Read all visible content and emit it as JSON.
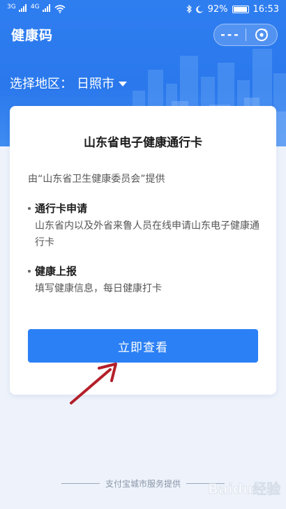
{
  "status_bar": {
    "signal_1": "3G",
    "signal_2": "4G",
    "battery": "92%",
    "time": "16:53",
    "icons": [
      "wifi-icon",
      "bluetooth-icon",
      "moon-icon",
      "battery-icon"
    ]
  },
  "header": {
    "title": "健康码",
    "more_icon": "more-icon",
    "close_icon": "close-icon"
  },
  "region": {
    "label": "选择地区：",
    "city": "日照市",
    "dropdown_icon": "caret-down-icon"
  },
  "card": {
    "title": "山东省电子健康通行卡",
    "provider": "由“山东省卫生健康委员会”提供",
    "sections": [
      {
        "heading": "通行卡申请",
        "body": "山东省内以及外省来鲁人员在线申请山东电子健康通行卡"
      },
      {
        "heading": "健康上报",
        "body": "填写健康信息，每日健康打卡"
      }
    ],
    "button_label": "立即查看"
  },
  "footer": {
    "text": "支付宝城市服务提供"
  },
  "watermark": {
    "text": "Baidu经验"
  },
  "colors": {
    "header_blue": "#2f7ef0",
    "button_blue": "#2b80f5",
    "arrow_red": "#b3202a",
    "page_bg": "#eef3fb"
  }
}
